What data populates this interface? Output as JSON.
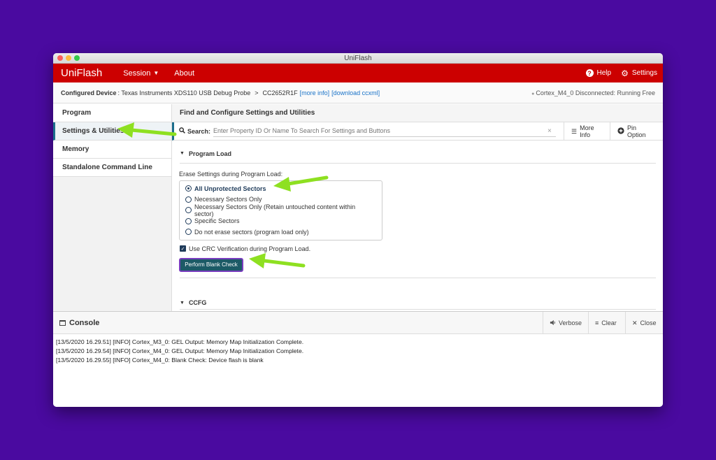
{
  "window": {
    "title": "UniFlash"
  },
  "appbar": {
    "brand": "UniFlash",
    "session": "Session",
    "about": "About",
    "help": "Help",
    "settings": "Settings"
  },
  "device": {
    "label": "Configured Device",
    "probe": ": Texas Instruments XDS110 USB Debug Probe",
    "separator": ">",
    "chip": "CC2652R1F",
    "more_info": "[more info]",
    "download": "[download ccxml]",
    "status": "Cortex_M4_0 Disconnected: Running Free"
  },
  "sidebar": {
    "items": [
      {
        "label": "Program"
      },
      {
        "label": "Settings & Utilities"
      },
      {
        "label": "Memory"
      },
      {
        "label": "Standalone Command Line"
      }
    ]
  },
  "main": {
    "title": "Find and Configure Settings and Utilities",
    "search": {
      "label": "Search:",
      "placeholder": "Enter Property ID Or Name To Search For Settings and Buttons",
      "clear": "×"
    },
    "more_info": "More Info",
    "pin_option": "Pin Option",
    "program_load": {
      "title": "Program Load",
      "erase_label": "Erase Settings during Program Load:",
      "options": [
        {
          "label": "All Unprotected Sectors"
        },
        {
          "label": "Necessary Sectors Only"
        },
        {
          "label": "Necessary Sectors Only (Retain untouched content within sector)"
        },
        {
          "label": "Specific Sectors"
        },
        {
          "label": "Do not erase sectors (program load only)"
        }
      ],
      "crc_label": "Use CRC Verification during Program Load.",
      "blank_check_button": "Perform Blank Check"
    },
    "ccfg": {
      "title": "CCFG"
    }
  },
  "console": {
    "title": "Console",
    "verbose": "Verbose",
    "clear": "Clear",
    "close": "Close",
    "lines": [
      "[13/5/2020 16.29.51] [INFO] Cortex_M3_0: GEL Output: Memory Map Initialization Complete.",
      "[13/5/2020 16.29.54] [INFO] Cortex_M4_0: GEL Output: Memory Map Initialization Complete.",
      "[13/5/2020 16.29.55] [INFO] Cortex_M4_0: Blank Check: Device flash is blank"
    ]
  },
  "colors": {
    "background": "#4a0aa0",
    "appbar": "#cc0000",
    "accent": "#1c6e8c",
    "arrow": "#8ee021"
  },
  "icons": {
    "help": "question-circle-icon",
    "settings": "gear-icon",
    "search": "search-icon",
    "more_info": "list-icon",
    "pin": "plus-circle-icon",
    "console": "window-icon",
    "verbose": "speaker-icon",
    "clear": "clear-lines-icon",
    "close": "close-icon",
    "annotation": "green-arrow-icon"
  }
}
